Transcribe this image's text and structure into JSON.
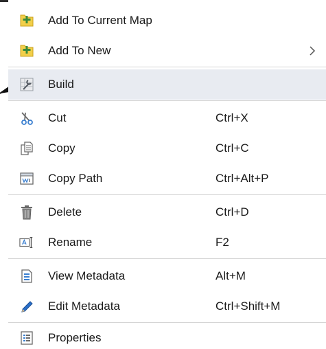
{
  "menu": {
    "add_to_current_map": {
      "label": "Add To Current Map",
      "icon": "add-layer-icon"
    },
    "add_to_new": {
      "label": "Add To New",
      "icon": "add-layer-icon",
      "has_submenu": true
    },
    "build": {
      "label": "Build",
      "icon": "build-wrench-icon",
      "highlighted": true
    },
    "cut": {
      "label": "Cut",
      "shortcut": "Ctrl+X",
      "icon": "scissors-icon"
    },
    "copy": {
      "label": "Copy",
      "shortcut": "Ctrl+C",
      "icon": "copy-icon"
    },
    "copy_path": {
      "label": "Copy Path",
      "shortcut": "Ctrl+Alt+P",
      "icon": "copy-path-icon"
    },
    "delete": {
      "label": "Delete",
      "shortcut": "Ctrl+D",
      "icon": "trash-icon"
    },
    "rename": {
      "label": "Rename",
      "shortcut": "F2",
      "icon": "rename-icon"
    },
    "view_metadata": {
      "label": "View Metadata",
      "shortcut": "Alt+M",
      "icon": "view-metadata-icon"
    },
    "edit_metadata": {
      "label": "Edit Metadata",
      "shortcut": "Ctrl+Shift+M",
      "icon": "pencil-icon"
    },
    "properties": {
      "label": "Properties",
      "icon": "properties-icon"
    }
  },
  "colors": {
    "highlight": "#e8ebf1",
    "separator": "#d4d4d4",
    "text": "#1a1a1a",
    "folder_yellow": "#f2cf4a",
    "plus_green": "#3a8a3a",
    "pencil_blue": "#2a6fc9"
  }
}
